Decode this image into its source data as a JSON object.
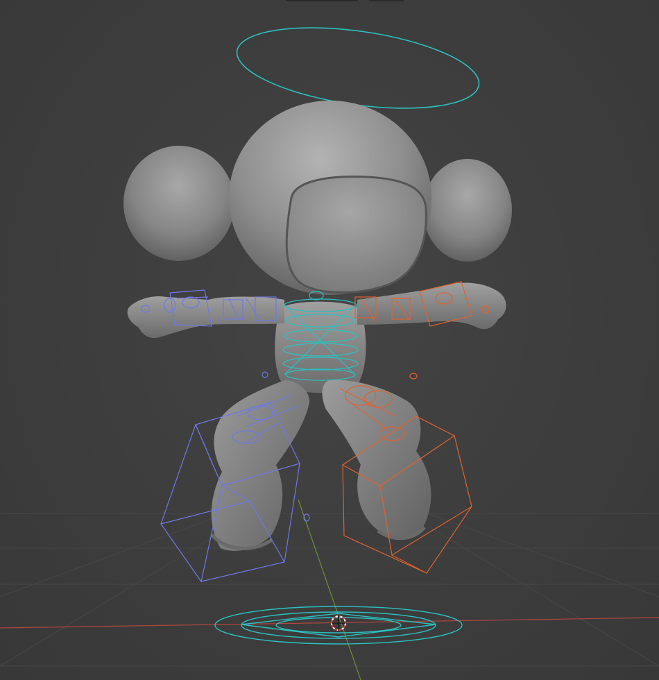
{
  "viewport": {
    "background": "#3d3d3d",
    "grid_color": "#4a4a4a",
    "x_axis_color": "#b2463e",
    "y_axis_color": "#6e8e3c"
  },
  "mesh": {
    "body_color": "#8a8a8a",
    "highlight_color": "#b8b8b8",
    "shadow_color": "#5c5c5c"
  },
  "rig": {
    "center_color": "#2bc1c1",
    "left_color": "#6f78e6",
    "right_color": "#e0622f"
  },
  "icons": [
    "3d-cursor-icon"
  ]
}
